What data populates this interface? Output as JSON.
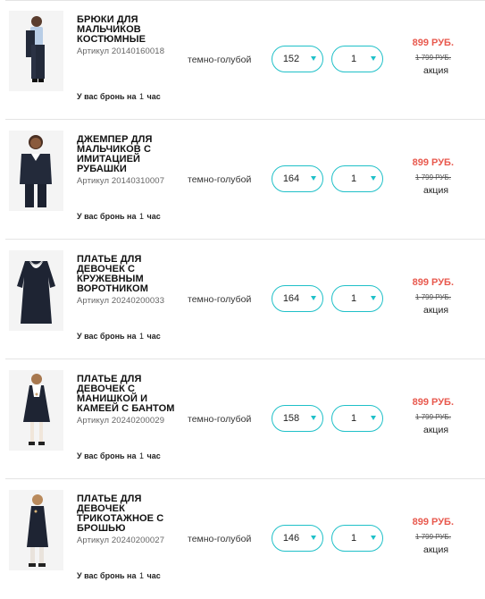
{
  "reserve": {
    "prefix": "У вас бронь на",
    "hours": "1",
    "suffix": "час"
  },
  "items": [
    {
      "title": "БРЮКИ ДЛЯ МАЛЬЧИКОВ КОСТЮМНЫЕ",
      "sku": "Артикул 20140160018",
      "color": "темно-голубой",
      "size": "152",
      "qty": "1",
      "price_new": "899 РУБ.",
      "price_old": "1 799 РУБ.",
      "promo": "акция",
      "thumb": "boy-suit"
    },
    {
      "title": "ДЖЕМПЕР ДЛЯ МАЛЬЧИКОВ С ИМИТАЦИЕЙ РУБАШКИ",
      "sku": "Артикул 20140310007",
      "color": "темно-голубой",
      "size": "164",
      "qty": "1",
      "price_new": "899 РУБ.",
      "price_old": "1 799 РУБ.",
      "promo": "акция",
      "thumb": "boy-jumper"
    },
    {
      "title": "ПЛАТЬЕ ДЛЯ ДЕВОЧЕК С КРУЖЕВНЫМ ВОРОТНИКОМ",
      "sku": "Артикул 20240200033",
      "color": "темно-голубой",
      "size": "164",
      "qty": "1",
      "price_new": "899 РУБ.",
      "price_old": "1 799 РУБ.",
      "promo": "акция",
      "thumb": "dress-flat"
    },
    {
      "title": "ПЛАТЬЕ ДЛЯ ДЕВОЧЕК С МАНИШКОЙ И КАМЕЕЙ С БАНТОМ",
      "sku": "Артикул 20240200029",
      "color": "темно-голубой",
      "size": "158",
      "qty": "1",
      "price_new": "899 РУБ.",
      "price_old": "1 799 РУБ.",
      "promo": "акция",
      "thumb": "girl-dress-bow"
    },
    {
      "title": "ПЛАТЬЕ ДЛЯ ДЕВОЧЕК ТРИКОТАЖНОЕ С БРОШЬЮ",
      "sku": "Артикул 20240200027",
      "color": "темно-голубой",
      "size": "146",
      "qty": "1",
      "price_new": "899 РУБ.",
      "price_old": "1 799 РУБ.",
      "promo": "акция",
      "thumb": "girl-dress-brooch"
    }
  ],
  "colors": {
    "accent": "#1fc0c8",
    "price": "#e85a4f",
    "navy": "#1e2433"
  }
}
